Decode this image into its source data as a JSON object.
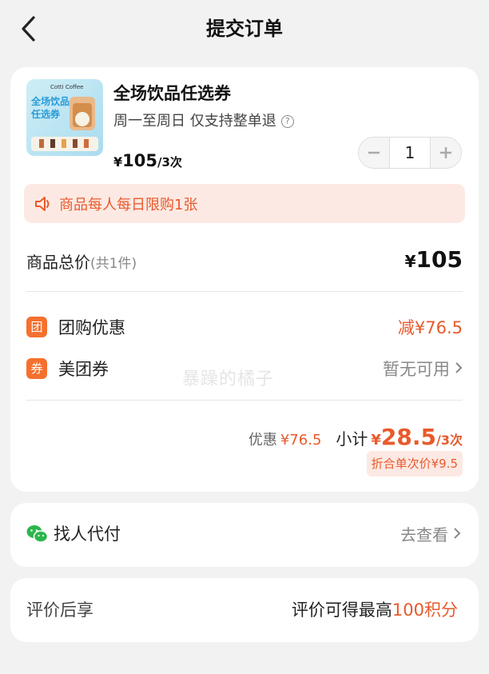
{
  "header": {
    "title": "提交订单",
    "back_icon": "chevron-left-icon"
  },
  "product": {
    "name": "全场饮品任选券",
    "subtitle": "周一至周日 仅支持整单退",
    "price_symbol": "¥",
    "price": "105",
    "price_unit": "/3次",
    "quantity": "1",
    "thumbnail_brand": "Cotti Coffee",
    "thumbnail_text": "全场饮品任选券"
  },
  "notice": {
    "text": "商品每人每日限购1张"
  },
  "totals": {
    "label": "商品总价",
    "count_text": "(共1件)",
    "price_symbol": "¥",
    "price": "105"
  },
  "discounts": [
    {
      "tag": "团",
      "label": "团购优惠",
      "value": "减¥76.5"
    },
    {
      "tag": "券",
      "label": "美团券",
      "value": "暂无可用"
    }
  ],
  "summary": {
    "discount_label": "优惠",
    "discount_value": "¥76.5",
    "subtotal_label": "小计",
    "subtotal_symbol": "¥",
    "subtotal": "28.5",
    "subtotal_unit": "/3次",
    "per_use_label": "折合单次价¥9.5"
  },
  "pay_for_me": {
    "label": "找人代付",
    "link": "去查看"
  },
  "review": {
    "label": "评价后享",
    "text": "评价可得最高",
    "points": "100积分"
  },
  "watermark": "暴躁的橘子",
  "colors": {
    "accent": "#e85a2c",
    "tag_bg": "#f5702e",
    "notice_bg": "#fde9e3",
    "wechat_green": "#2bb64c"
  }
}
